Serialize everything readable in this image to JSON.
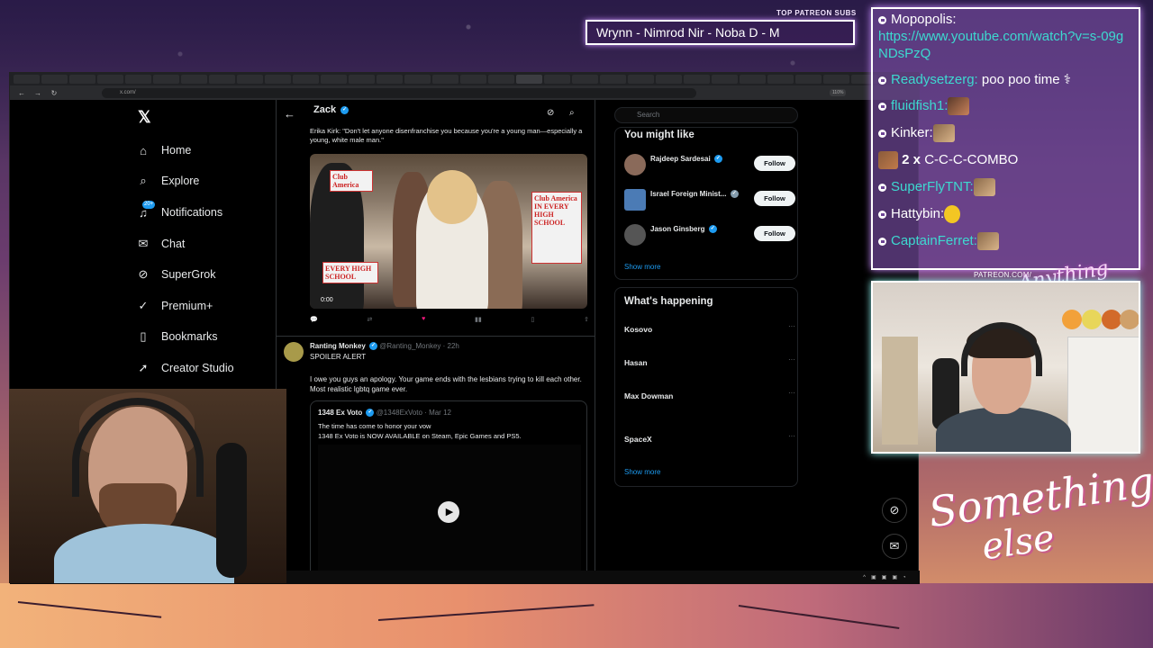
{
  "overlay": {
    "patreon_label": "TOP PATREON SUBS",
    "ticker_text": "Wrynn - Nimrod Nir - Noba D - M",
    "patreon_url": "PATREON.COM/",
    "logo_small": "Anything else?",
    "logo_big_1": "Something",
    "logo_big_2": "else"
  },
  "browser": {
    "url": "x.com/",
    "zoom": "110%",
    "tabs": [
      "",
      "",
      "",
      "",
      "",
      "",
      "",
      "",
      "",
      "",
      "",
      "",
      "",
      "",
      "",
      "",
      "",
      "",
      "",
      "",
      "",
      "",
      "",
      "",
      "",
      "",
      "",
      "",
      "",
      "",
      ""
    ]
  },
  "sidebar": {
    "items": [
      {
        "label": "Home",
        "icon": "home-icon"
      },
      {
        "label": "Explore",
        "icon": "search-icon"
      },
      {
        "label": "Notifications",
        "icon": "bell-icon",
        "badge": "20+"
      },
      {
        "label": "Chat",
        "icon": "mail-icon"
      },
      {
        "label": "SuperGrok",
        "icon": "grok-icon"
      },
      {
        "label": "Premium+",
        "icon": "premium-icon"
      },
      {
        "label": "Bookmarks",
        "icon": "bookmark-icon"
      },
      {
        "label": "Creator Studio",
        "icon": "rocket-icon"
      }
    ]
  },
  "main": {
    "profile_name": "Zack",
    "profile_posts": "",
    "quote_text": "Erika Kirk: \"Don't let anyone disenfranchise you because you're a young man—especially a young, white male man.\"",
    "video_time": "0:00",
    "video_signs": [
      "Club America",
      "Club America IN EVERY HIGH SCHOOL",
      "EVERY HIGH SCHOOL"
    ],
    "actions": {
      "replies": "",
      "reposts": "",
      "likes": "",
      "views": ""
    },
    "post2": {
      "name": "Ranting Monkey",
      "handle": "@Ranting_Monkey · 22h",
      "spoiler": "SPOILER ALERT",
      "body": "I owe you guys an apology. Your game ends with the lesbians trying to kill each other. Most realistic lgbtq game ever.",
      "quote_name": "1348 Ex Voto",
      "quote_handle": "@1348ExVoto · Mar 12",
      "quote_body_1": "The time has come to honor your vow",
      "quote_body_2": "1348 Ex Voto is NOW AVAILABLE on Steam, Epic Games and PS5."
    }
  },
  "right": {
    "search_placeholder": "Search",
    "you_might_like": "You might like",
    "follow_label": "Follow",
    "suggestions": [
      {
        "name": "Rajdeep Sardesai",
        "handle": ""
      },
      {
        "name": "Israel Foreign Minist...",
        "handle": ""
      },
      {
        "name": "Jason Ginsberg",
        "handle": ""
      }
    ],
    "show_more": "Show more",
    "whats_happening": "What's happening",
    "trends": [
      {
        "context": "",
        "name": "Kosovo",
        "sub": ""
      },
      {
        "context": "",
        "name": "Hasan",
        "sub": ""
      },
      {
        "context": "",
        "name": "Max Dowman",
        "sub": ""
      },
      {
        "context": "",
        "name": "SpaceX",
        "sub": ""
      }
    ],
    "show_more_2": "Show more",
    "footer": ""
  },
  "chat": {
    "messages": [
      {
        "user": "Mopopolis:",
        "user_color": "#ffffff",
        "text": "",
        "link": "https://www.youtube.com/watch?v=s-09gNDsPzQ"
      },
      {
        "user": "Readysetzerg:",
        "user_color": "#3dd9d0",
        "text": "poo poo time"
      },
      {
        "user": "fluidfish1:",
        "user_color": "#3dd9d0",
        "text": "",
        "emote": "kappa"
      },
      {
        "user": "Kinker:",
        "user_color": "#ffffff",
        "text": "",
        "emote": "ferret"
      },
      {
        "user": "",
        "combo_count": "2 x",
        "text": "C-C-C-COMBO",
        "emote": "combo"
      },
      {
        "user": "SuperFlyTNT:",
        "user_color": "#3dd9d0",
        "text": "",
        "emote": "ferret"
      },
      {
        "user": "Hattybin:",
        "user_color": "#ffffff",
        "text": "",
        "emote": "yellow"
      },
      {
        "user": "CaptainFerret:",
        "user_color": "#3dd9d0",
        "text": "",
        "emote": "ferret"
      }
    ]
  },
  "colors": {
    "accent_blue": "#1d9bf0",
    "chat_teal": "#3dd9d0",
    "like_pink": "#f91880"
  }
}
